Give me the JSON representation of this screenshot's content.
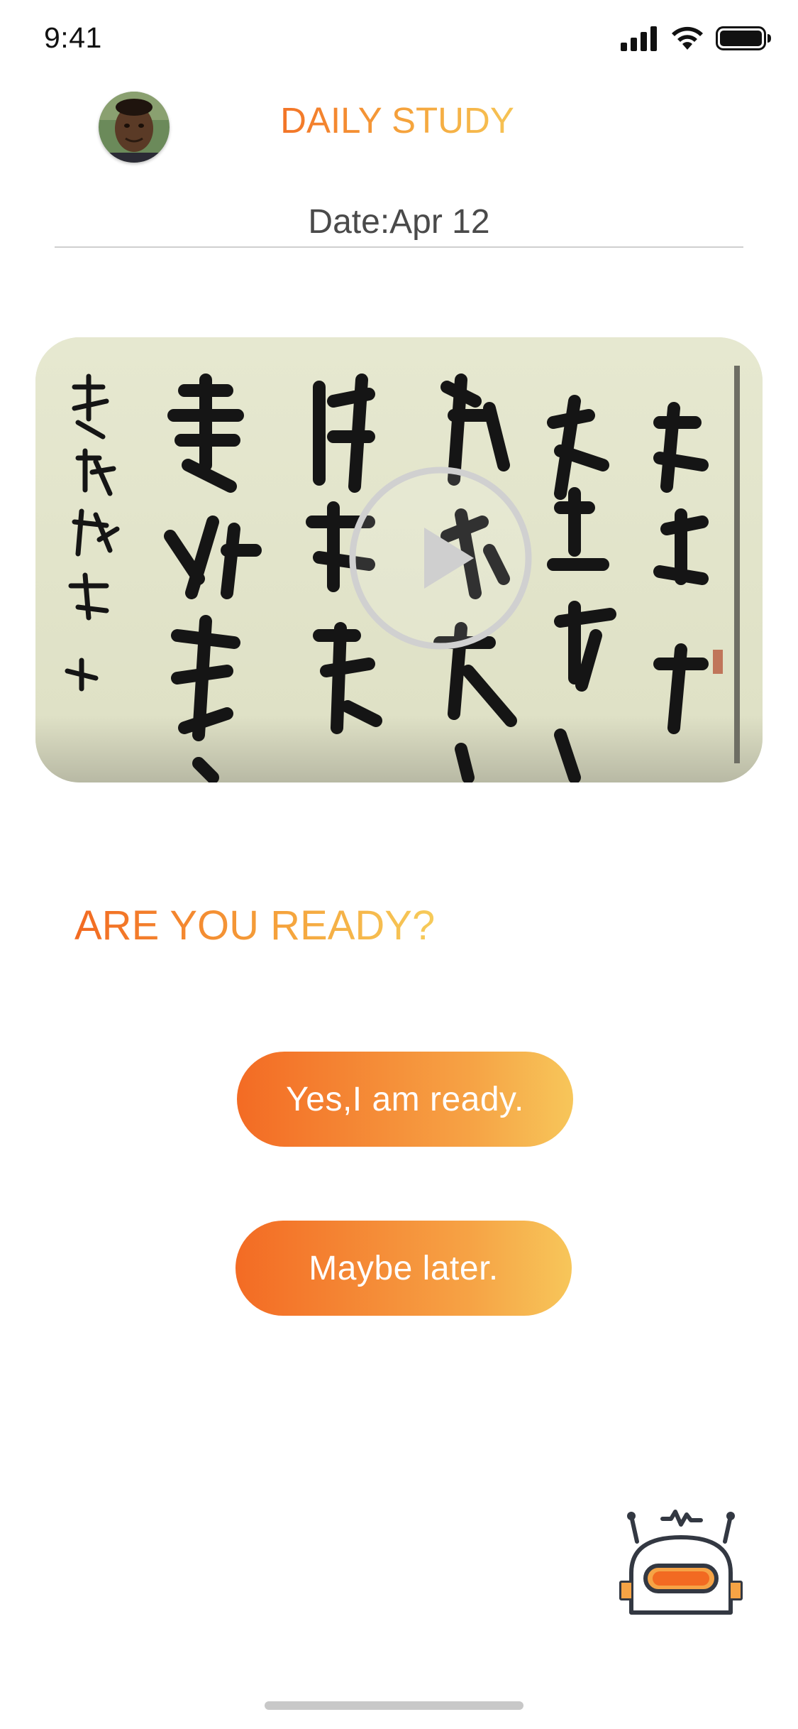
{
  "status_bar": {
    "time": "9:41",
    "icons": [
      "signal-icon",
      "wifi-icon",
      "battery-icon"
    ]
  },
  "header": {
    "title": "DAILY STUDY",
    "date": "Date:Apr 12",
    "avatar": "user-avatar"
  },
  "video": {
    "thumbnail": "chinese-calligraphy-scroll",
    "play_icon": "play-icon"
  },
  "prompt": {
    "question": "ARE YOU READY?",
    "yes_label": "Yes,I am ready.",
    "later_label": "Maybe later."
  },
  "assistant": {
    "icon": "robot-icon"
  },
  "colors": {
    "accent_start": "#f26a22",
    "accent_end": "#f6cb5a",
    "text_gray": "#4a4a4a"
  }
}
